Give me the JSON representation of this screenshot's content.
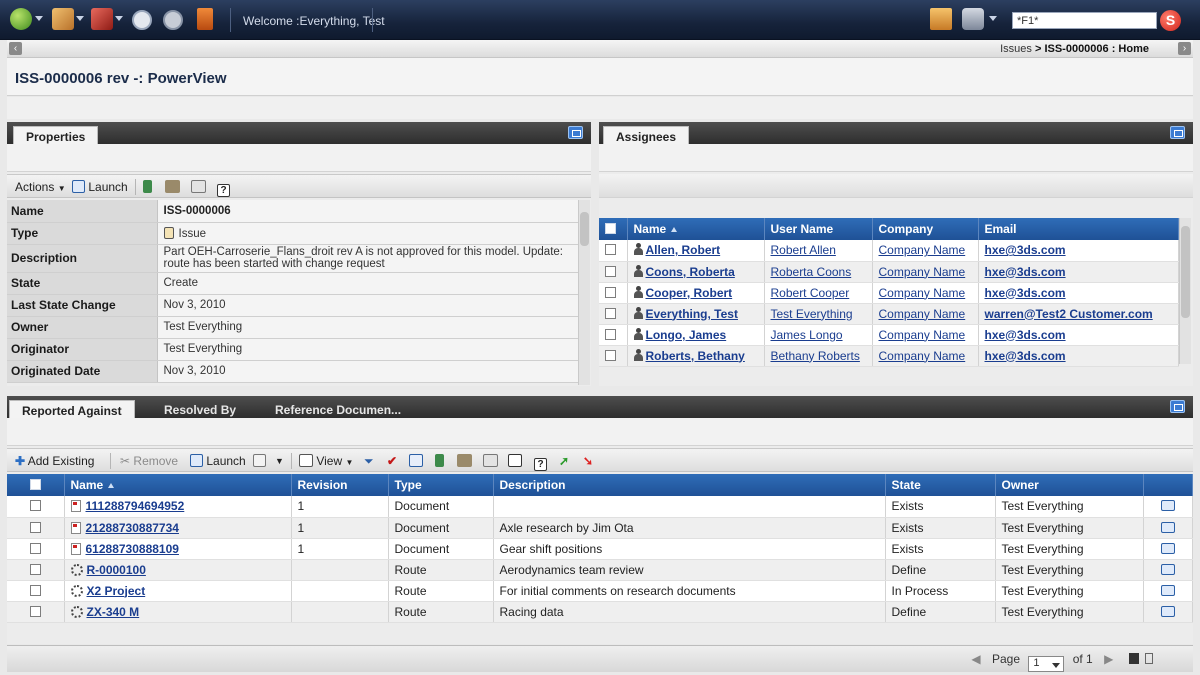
{
  "topbar": {
    "welcome": "Welcome :Everything, Test",
    "search_value": "*F1*",
    "icons": [
      "compass-icon",
      "tools-icon",
      "actions-icon",
      "back-icon",
      "forward-icon",
      "logout-icon",
      "home-icon",
      "binoculars-icon",
      "brand-logo-icon"
    ]
  },
  "breadcrumb": {
    "first": "Issues",
    "sep": " > ",
    "second": "ISS-0000006 : Home"
  },
  "page": {
    "title": "ISS-0000006 rev -: PowerView"
  },
  "properties": {
    "tab": "Properties",
    "toolbar": {
      "actions": "Actions",
      "launch": "Launch"
    },
    "rows": [
      {
        "key": "Name",
        "value": "ISS-0000006"
      },
      {
        "key": "Type",
        "value": "Issue"
      },
      {
        "key": "Description",
        "value": "Part OEH-Carroserie_Flans_droit rev A is not approved for this model. Update: route has been started with change request"
      },
      {
        "key": "State",
        "value": "Create"
      },
      {
        "key": "Last State Change",
        "value": "Nov 3, 2010"
      },
      {
        "key": "Owner",
        "value": "Test Everything"
      },
      {
        "key": "Originator",
        "value": "Test Everything"
      },
      {
        "key": "Originated Date",
        "value": "Nov 3, 2010"
      }
    ]
  },
  "assignees": {
    "tab": "Assignees",
    "columns": [
      "Name",
      "User Name",
      "Company",
      "Email"
    ],
    "rows": [
      {
        "name": "Allen, Robert",
        "user": "Robert Allen",
        "company": "Company Name",
        "email": "hxe@3ds.com"
      },
      {
        "name": "Coons, Roberta",
        "user": "Roberta Coons",
        "company": "Company Name",
        "email": "hxe@3ds.com"
      },
      {
        "name": "Cooper, Robert",
        "user": "Robert Cooper",
        "company": "Company Name",
        "email": "hxe@3ds.com"
      },
      {
        "name": "Everything, Test",
        "user": "Test Everything",
        "company": "Company Name",
        "email": "warren@Test2 Customer.com"
      },
      {
        "name": "Longo, James",
        "user": "James Longo",
        "company": "Company Name",
        "email": "hxe@3ds.com"
      },
      {
        "name": "Roberts, Bethany",
        "user": "Bethany Roberts",
        "company": "Company Name",
        "email": "hxe@3ds.com"
      }
    ]
  },
  "bottom": {
    "tabs": [
      "Reported Against",
      "Resolved By",
      "Reference Documen..."
    ],
    "toolbar": {
      "add_existing": "Add Existing",
      "remove": "Remove",
      "launch": "Launch",
      "view": "View"
    },
    "columns": [
      "Name",
      "Revision",
      "Type",
      "Description",
      "State",
      "Owner"
    ],
    "rows": [
      {
        "name": "111288794694952",
        "revision": "1",
        "type": "Document",
        "description": "",
        "state": "Exists",
        "owner": "Test Everything",
        "icon": "document-icon"
      },
      {
        "name": "21288730887734",
        "revision": "1",
        "type": "Document",
        "description": "Axle research by Jim Ota",
        "state": "Exists",
        "owner": "Test Everything",
        "icon": "document-icon"
      },
      {
        "name": "61288730888109",
        "revision": "1",
        "type": "Document",
        "description": "Gear shift positions",
        "state": "Exists",
        "owner": "Test Everything",
        "icon": "document-icon"
      },
      {
        "name": "R-0000100",
        "revision": "",
        "type": "Route",
        "description": "Aerodynamics team review",
        "state": "Define",
        "owner": "Test Everything",
        "icon": "route-icon"
      },
      {
        "name": "X2 Project",
        "revision": "",
        "type": "Route",
        "description": "For initial comments on research documents",
        "state": "In Process",
        "owner": "Test Everything",
        "icon": "route-icon"
      },
      {
        "name": "ZX-340 M",
        "revision": "",
        "type": "Route",
        "description": "Racing data",
        "state": "Define",
        "owner": "Test Everything",
        "icon": "route-icon"
      }
    ]
  },
  "pager": {
    "label": "Page",
    "current": "1",
    "of": "of 1"
  },
  "colors": {
    "header_blue": "#2f6db8",
    "topbar": "#16233b",
    "brand_red": "#d0241b"
  }
}
